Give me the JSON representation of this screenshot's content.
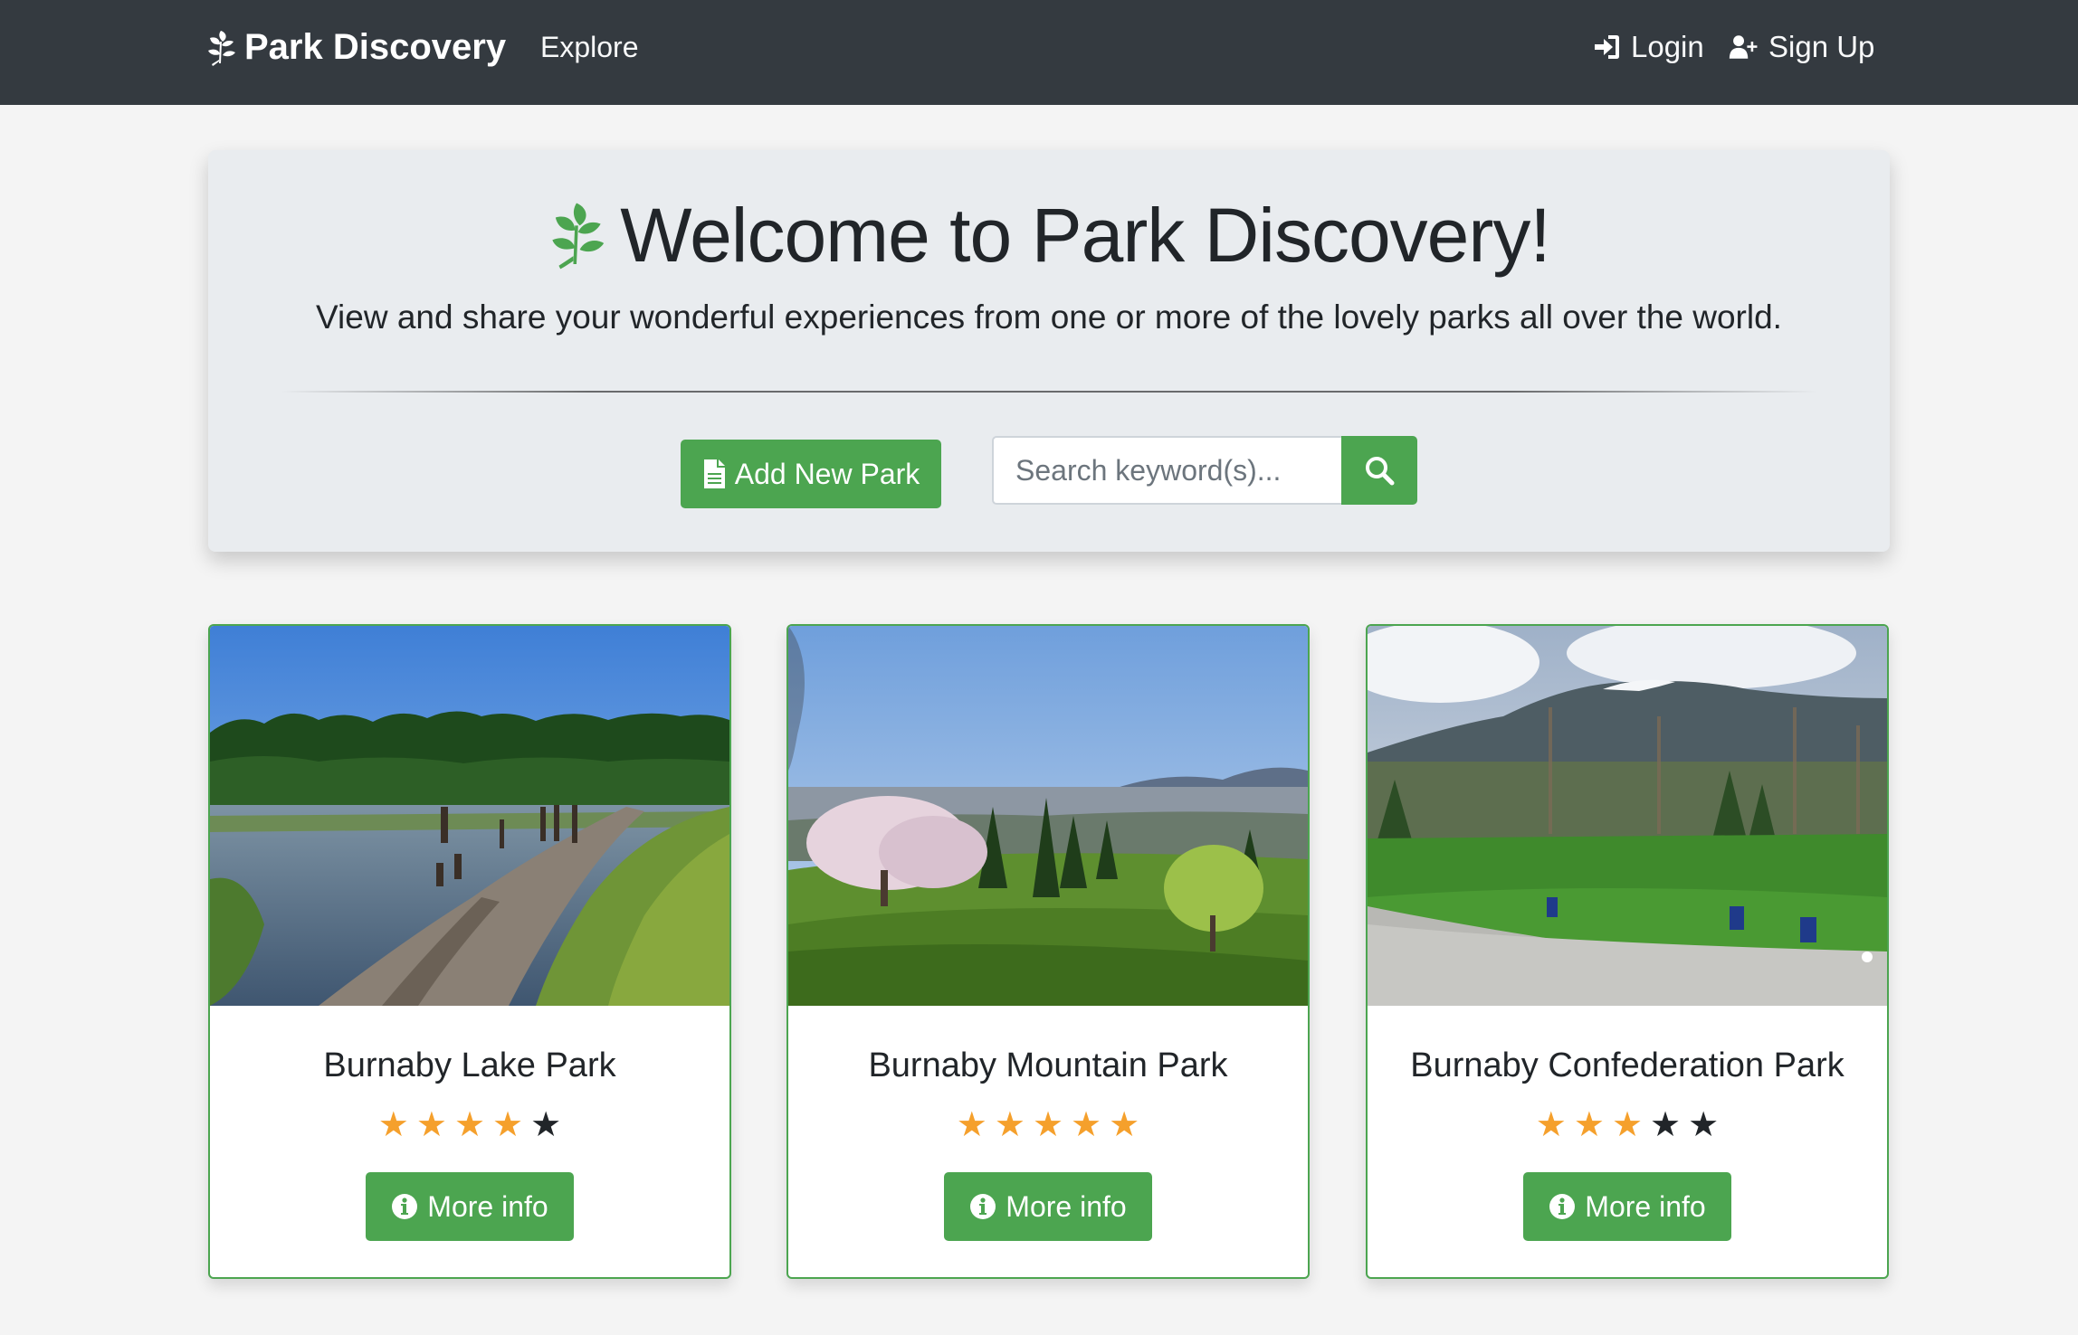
{
  "nav": {
    "brand": "Park Discovery",
    "explore": "Explore",
    "login": "Login",
    "signup": "Sign Up"
  },
  "hero": {
    "title": "Welcome to Park Discovery!",
    "lead": "View and share your wonderful experiences from one or more of the lovely parks all over the world.",
    "add_button": "Add New Park",
    "search_placeholder": "Search keyword(s)..."
  },
  "parks": [
    {
      "name": "Burnaby Lake Park",
      "rating": 4,
      "max_rating": 5,
      "button": "More info",
      "image": "lake boardwalk with trees"
    },
    {
      "name": "Burnaby Mountain Park",
      "rating": 5,
      "max_rating": 5,
      "button": "More info",
      "image": "hillside lawn with city view"
    },
    {
      "name": "Burnaby Confederation Park",
      "rating": 3,
      "max_rating": 5,
      "button": "More info",
      "image": "sports field with mountains"
    }
  ],
  "colors": {
    "navbar": "#343a40",
    "accent_green": "#4ca550",
    "star_active": "#f5a02c",
    "star_inactive": "#212529",
    "jumbotron": "#e9ecef"
  },
  "icons": {
    "brand": "leaf-icon",
    "login": "sign-in-icon",
    "signup": "user-plus-icon",
    "add": "file-icon",
    "search": "search-icon",
    "info": "info-circle-icon"
  }
}
